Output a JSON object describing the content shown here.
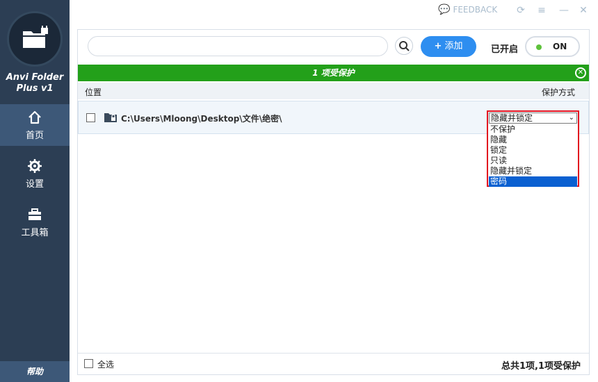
{
  "app": {
    "name_line1": "Anvi Folder",
    "name_line2": "Plus v1"
  },
  "sidebar": {
    "items": [
      {
        "label": "首页",
        "icon": "home-icon"
      },
      {
        "label": "设置",
        "icon": "gear-icon"
      },
      {
        "label": "工具箱",
        "icon": "toolbox-icon"
      }
    ],
    "help_label": "帮助"
  },
  "titlebar": {
    "feedback_label": "FEEDBACK"
  },
  "toolbar": {
    "search_value": "",
    "add_label": "添加",
    "protect_label": "已开启",
    "toggle_label": "ON"
  },
  "banner": {
    "text": "1 项受保护"
  },
  "table": {
    "col_location": "位置",
    "col_mode": "保护方式",
    "rows": [
      {
        "path": "C:\\Users\\Mloong\\Desktop\\文件\\绝密\\",
        "mode": "隐藏并锁定"
      }
    ]
  },
  "dropdown": {
    "current": "隐藏并锁定",
    "options": [
      "不保护",
      "隐藏",
      "锁定",
      "只读",
      "隐藏并锁定",
      "密码"
    ],
    "highlighted": "密码"
  },
  "footer": {
    "select_all": "全选",
    "summary": "总共1项,1项受保护"
  },
  "colors": {
    "accent_blue": "#2e8ef0",
    "banner_green": "#23a01a",
    "sidebar": "#2c3e54",
    "highlight_red": "#e2101e"
  }
}
